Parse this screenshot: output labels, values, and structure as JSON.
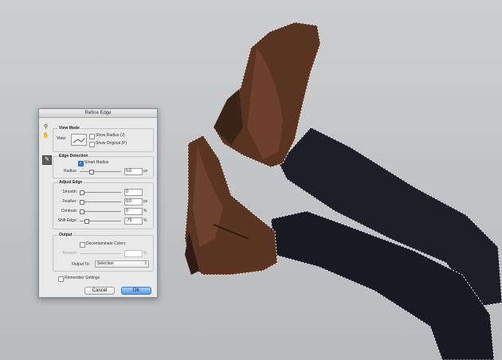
{
  "dialog": {
    "title": "Refine Edge",
    "tool_icons": [
      "zoom-icon",
      "hand-icon",
      "refine-radius-brush-icon"
    ],
    "view_mode": {
      "group_label": "View Mode",
      "view_label": "View:",
      "show_radius_label": "Show Radius (J)",
      "show_original_label": "Show Original (P)"
    },
    "edge_detection": {
      "group_label": "Edge Detection",
      "smart_radius_label": "Smart Radius",
      "smart_radius_checked": true,
      "radius_label": "Radius:",
      "radius_value": "5.6",
      "radius_unit": "px",
      "radius_level": 0.25
    },
    "adjust_edge": {
      "group_label": "Adjust Edge",
      "smooth": {
        "label": "Smooth:",
        "value": "0",
        "unit": "",
        "level": 0
      },
      "feather": {
        "label": "Feather:",
        "value": "0.0",
        "unit": "px",
        "level": 0
      },
      "contrast": {
        "label": "Contrast:",
        "value": "0",
        "unit": "%",
        "level": 0
      },
      "shift_edge": {
        "label": "Shift Edge:",
        "value": "-76",
        "unit": "%",
        "level": 0.12
      }
    },
    "output": {
      "group_label": "Output",
      "decontaminate_label": "Decontaminate Colors",
      "amount_label": "Amount:",
      "amount_unit": "%",
      "output_to_label": "Output To:",
      "output_to_value": "Selection"
    },
    "remember_label": "Remember Settings",
    "cancel_label": "Cancel",
    "ok_label": "OK"
  }
}
